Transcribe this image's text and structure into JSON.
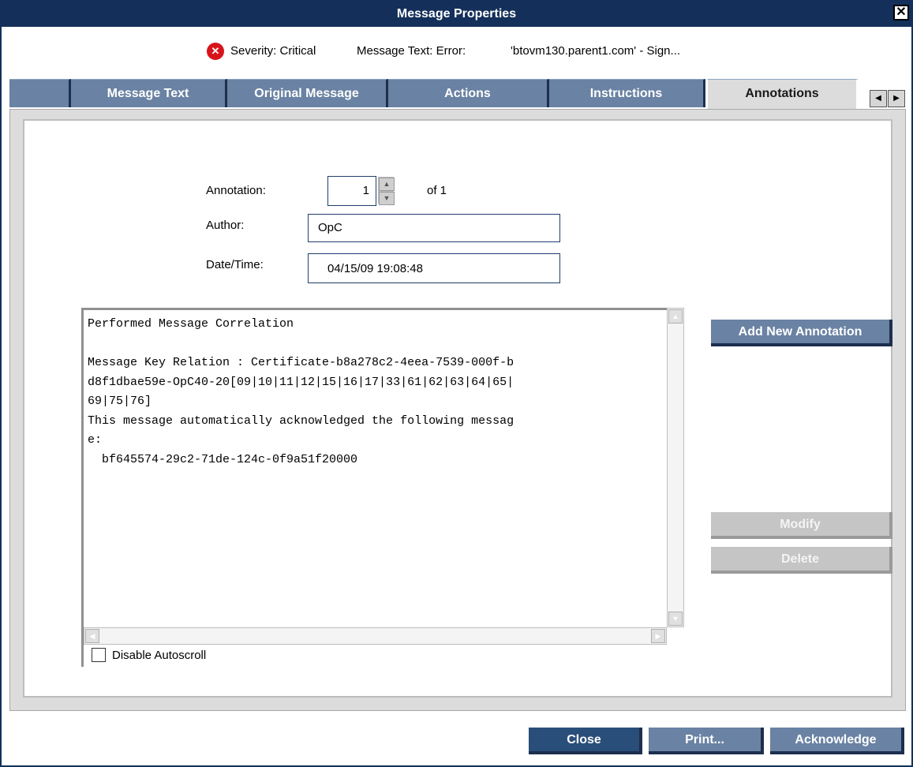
{
  "window": {
    "title": "Message Properties"
  },
  "info": {
    "severity_label": "Severity: Critical",
    "message_text_label": "Message Text: Error:",
    "message_text_value": "'btovm130.parent1.com' - Sign..."
  },
  "tabs": [
    {
      "label": ""
    },
    {
      "label": "Message Text"
    },
    {
      "label": "Original Message"
    },
    {
      "label": "Actions"
    },
    {
      "label": "Instructions"
    },
    {
      "label": "Annotations"
    }
  ],
  "form": {
    "annotation_label": "Annotation:",
    "annotation_value": "1",
    "annotation_of": "of 1",
    "author_label": "Author:",
    "author_value": "OpC",
    "datetime_label": "Date/Time:",
    "datetime_value": "04/15/09 19:08:48"
  },
  "annotation_text": {
    "lines": [
      "Performed Message Correlation",
      "",
      "Message Key Relation : Certificate-b8a278c2-4eea-7539-000f-b",
      "d8f1dbae59e-OpC40-20[09|10|11|12|15|16|17|33|61|62|63|64|65|",
      "69|75|76]",
      "This message automatically acknowledged the following messag",
      "e:",
      "  bf645574-29c2-71de-124c-0f9a51f20000"
    ]
  },
  "side_buttons": {
    "add_new": "Add New Annotation",
    "modify": "Modify",
    "delete": "Delete"
  },
  "checkbox": {
    "label": "Disable Autoscroll"
  },
  "footer": {
    "close": "Close",
    "print": "Print...",
    "acknowledge": "Acknowledge"
  },
  "colors": {
    "title_bar": "#14305a",
    "tab_inactive": "#6a82a3",
    "button_primary": "#2a4e7a",
    "severity_critical": "#d8141b"
  }
}
